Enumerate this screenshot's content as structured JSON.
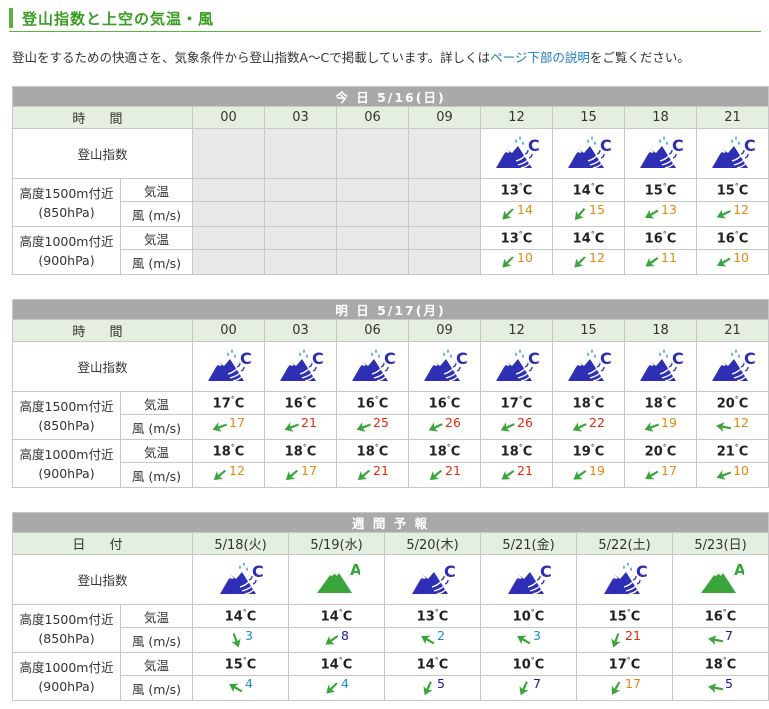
{
  "title": "登山指数と上空の気温・風",
  "intro": {
    "before": "登山をするための快適さを、気象条件から登山指数A〜Cで掲載しています。詳しくは",
    "link": "ページ下部の説明",
    "after": "をご覧ください。"
  },
  "labels": {
    "time": "時 間",
    "index": "登山指数",
    "alt1500": "高度1500m付近",
    "hpa850": "(850hPa)",
    "alt1000": "高度1000m付近",
    "hpa900": "(900hPa)",
    "temp": "気温",
    "wind": "風 (m/s)",
    "date": "日 付"
  },
  "colors": {
    "accent": "#59b33c",
    "head": "#a9a9a9",
    "subhead": "#e4efe1",
    "mountain_c": "#2f2fb5",
    "mountain_a": "#3aa53a"
  },
  "today": {
    "header": "今 日 5/16(日)",
    "hours": [
      "00",
      "03",
      "06",
      "09",
      "12",
      "15",
      "18",
      "21"
    ],
    "index": [
      null,
      null,
      null,
      null,
      "C",
      "C",
      "C",
      "C"
    ],
    "icons": [
      null,
      null,
      null,
      null,
      "rain-wind",
      "rain-wind",
      "rain-wind",
      "rain-wind"
    ],
    "t1500": [
      null,
      null,
      null,
      null,
      "13",
      "14",
      "15",
      "15"
    ],
    "w1500": [
      null,
      null,
      null,
      null,
      {
        "v": "14",
        "c": "orange",
        "d": 225
      },
      {
        "v": "15",
        "c": "orange",
        "d": 220
      },
      {
        "v": "13",
        "c": "orange",
        "d": 240
      },
      {
        "v": "12",
        "c": "orange",
        "d": 245
      }
    ],
    "t1000": [
      null,
      null,
      null,
      null,
      "13",
      "14",
      "16",
      "16"
    ],
    "w1000": [
      null,
      null,
      null,
      null,
      {
        "v": "10",
        "c": "orange",
        "d": 225
      },
      {
        "v": "12",
        "c": "orange",
        "d": 225
      },
      {
        "v": "11",
        "c": "orange",
        "d": 235
      },
      {
        "v": "10",
        "c": "orange",
        "d": 240
      }
    ]
  },
  "tomorrow": {
    "header": "明 日 5/17(月)",
    "hours": [
      "00",
      "03",
      "06",
      "09",
      "12",
      "15",
      "18",
      "21"
    ],
    "index": [
      "C",
      "C",
      "C",
      "C",
      "C",
      "C",
      "C",
      "C"
    ],
    "icons": [
      "rain-wind",
      "rain-wind",
      "rain-wind",
      "rain-wind",
      "rain-wind",
      "rain-wind",
      "rain-wind",
      "rain-wind"
    ],
    "t1500": [
      "17",
      "16",
      "16",
      "16",
      "17",
      "18",
      "18",
      "20"
    ],
    "w1500": [
      {
        "v": "17",
        "c": "orange",
        "d": 250
      },
      {
        "v": "21",
        "c": "red",
        "d": 250
      },
      {
        "v": "25",
        "c": "red",
        "d": 250
      },
      {
        "v": "26",
        "c": "red",
        "d": 245
      },
      {
        "v": "26",
        "c": "red",
        "d": 245
      },
      {
        "v": "22",
        "c": "red",
        "d": 245
      },
      {
        "v": "19",
        "c": "orange",
        "d": 250
      },
      {
        "v": "12",
        "c": "orange",
        "d": 280
      }
    ],
    "t1000": [
      "18",
      "18",
      "18",
      "18",
      "18",
      "19",
      "20",
      "21"
    ],
    "w1000": [
      {
        "v": "12",
        "c": "orange",
        "d": 230
      },
      {
        "v": "17",
        "c": "orange",
        "d": 230
      },
      {
        "v": "21",
        "c": "red",
        "d": 230
      },
      {
        "v": "21",
        "c": "red",
        "d": 230
      },
      {
        "v": "21",
        "c": "red",
        "d": 235
      },
      {
        "v": "19",
        "c": "orange",
        "d": 235
      },
      {
        "v": "17",
        "c": "orange",
        "d": 240
      },
      {
        "v": "10",
        "c": "orange",
        "d": 250
      }
    ]
  },
  "weekly": {
    "header": "週 間 予 報",
    "dates": [
      "5/18(火)",
      "5/19(水)",
      "5/20(木)",
      "5/21(金)",
      "5/22(土)",
      "5/23(日)"
    ],
    "index": [
      "C",
      "A",
      "C",
      "C",
      "C",
      "A"
    ],
    "icons": [
      "rain-wind",
      "sun",
      "wind",
      "wind",
      "rain-wind",
      "sun"
    ],
    "t1500": [
      "14",
      "14",
      "13",
      "10",
      "15",
      "16"
    ],
    "w1500": [
      {
        "v": "3",
        "c": "blue",
        "d": 160
      },
      {
        "v": "8",
        "c": "navy",
        "d": 235
      },
      {
        "v": "2",
        "c": "blue",
        "d": 300
      },
      {
        "v": "3",
        "c": "blue",
        "d": 300
      },
      {
        "v": "21",
        "c": "red",
        "d": 200
      },
      {
        "v": "7",
        "c": "navy",
        "d": 280
      }
    ],
    "t1000": [
      "15",
      "14",
      "14",
      "10",
      "17",
      "18"
    ],
    "w1000": [
      {
        "v": "4",
        "c": "blue",
        "d": 300
      },
      {
        "v": "4",
        "c": "blue",
        "d": 225
      },
      {
        "v": "5",
        "c": "navy",
        "d": 205
      },
      {
        "v": "7",
        "c": "navy",
        "d": 205
      },
      {
        "v": "17",
        "c": "orange",
        "d": 210
      },
      {
        "v": "5",
        "c": "navy",
        "d": 280
      }
    ]
  }
}
